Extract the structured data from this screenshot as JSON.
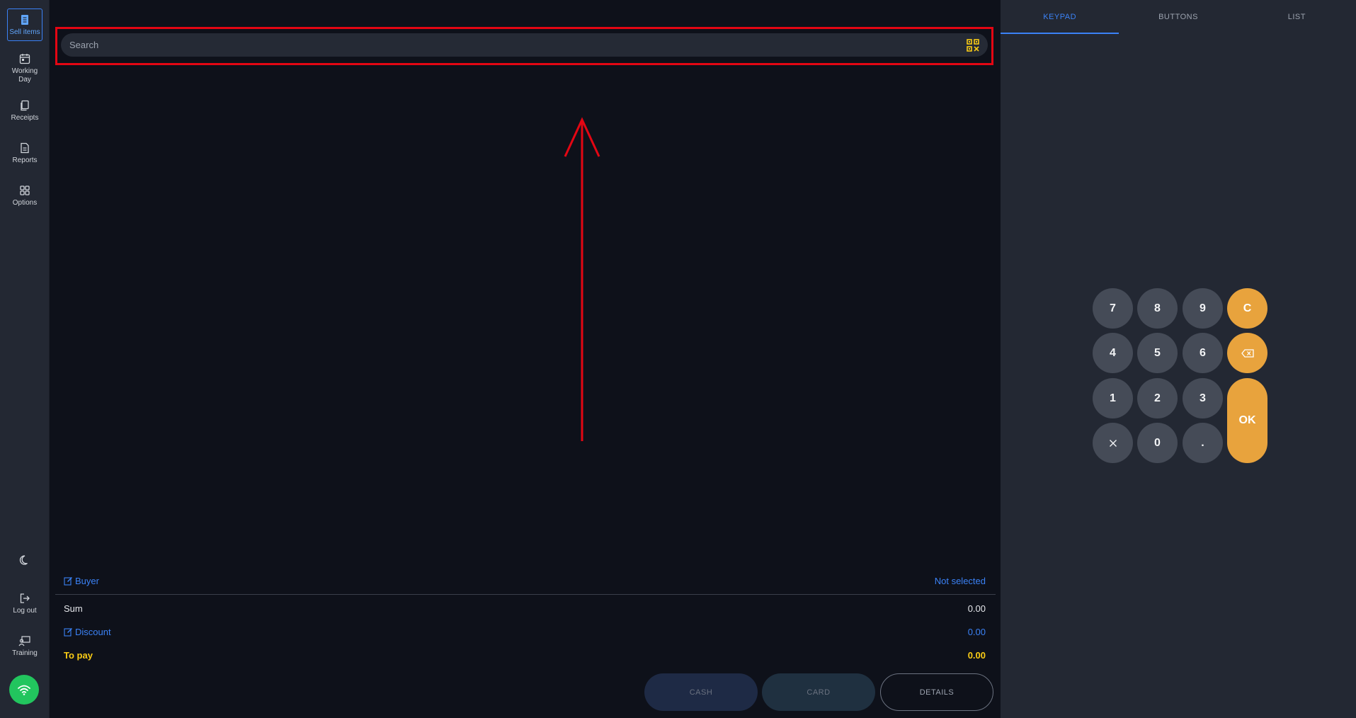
{
  "sidebar": {
    "items": [
      {
        "label": "Sell items"
      },
      {
        "label": "Working Day"
      },
      {
        "label": "Receipts"
      },
      {
        "label": "Reports"
      },
      {
        "label": "Options"
      }
    ],
    "logout": "Log out",
    "training": "Training"
  },
  "search": {
    "placeholder": "Search"
  },
  "summary": {
    "buyer_label": "Buyer",
    "buyer_value": "Not selected",
    "sum_label": "Sum",
    "sum_value": "0.00",
    "discount_label": "Discount",
    "discount_value": "0.00",
    "topay_label": "To pay",
    "topay_value": "0.00"
  },
  "payment": {
    "cash": "CASH",
    "card": "CARD",
    "details": "DETAILS"
  },
  "tabs": [
    "KEYPAD",
    "BUTTONS",
    "LIST"
  ],
  "keypad": {
    "k7": "7",
    "k8": "8",
    "k9": "9",
    "clear": "C",
    "k4": "4",
    "k5": "5",
    "k6": "6",
    "k1": "1",
    "k2": "2",
    "k3": "3",
    "ok": "OK",
    "k0": "0",
    "dot": "."
  },
  "colors": {
    "accent": "#3b82f6",
    "orange": "#e8a33d",
    "highlight": "#e30613",
    "yellow": "#facc15",
    "green": "#22c55e"
  }
}
